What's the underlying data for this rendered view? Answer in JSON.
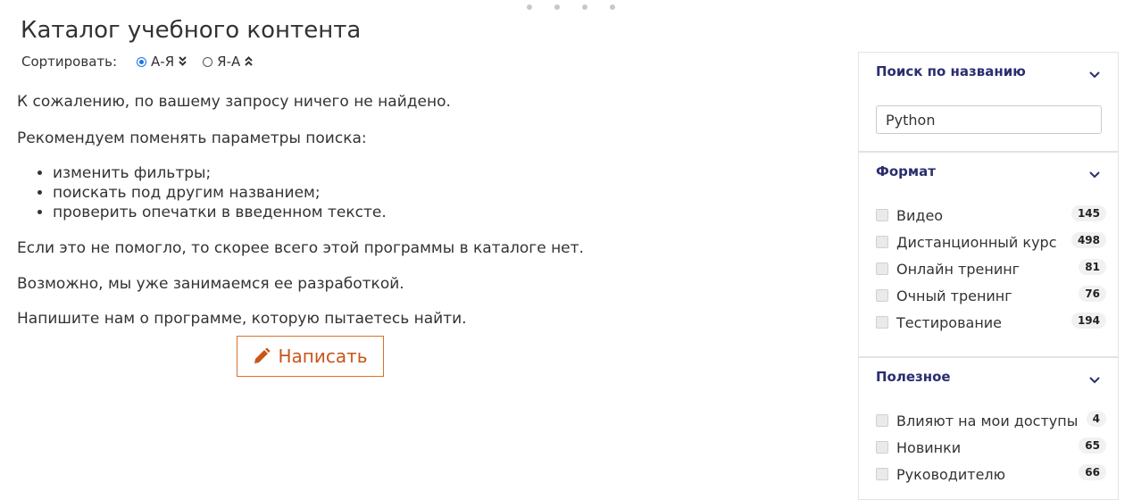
{
  "page": {
    "title": "Каталог учебного контента",
    "sort_label": "Сортировать:",
    "sort_options": [
      {
        "label": "А-Я",
        "checked": true,
        "direction": "descending-arrows"
      },
      {
        "label": "Я-А",
        "checked": false,
        "direction": "ascending-arrows"
      }
    ]
  },
  "message": {
    "not_found": "К сожалению, по вашему запросу ничего не найдено.",
    "recommend": "Рекомендуем поменять параметры поиска:",
    "tips": [
      "изменить фильтры;",
      "поискать под другим названием;",
      "проверить опечатки в введенном тексте."
    ],
    "not_helped": "Если это не помогло, то скорее всего этой программы в каталоге нет.",
    "developing": "Возможно, мы уже занимаемся ее разработкой.",
    "write_us": "Напишите нам о программе, которую пытаетесь найти.",
    "write_button": "Написать"
  },
  "sidebar": {
    "search": {
      "title": "Поиск по названию",
      "value": "Python"
    },
    "format": {
      "title": "Формат",
      "items": [
        {
          "label": "Видео",
          "count": "145"
        },
        {
          "label": "Дистанционный курс",
          "count": "498"
        },
        {
          "label": "Онлайн тренинг",
          "count": "81"
        },
        {
          "label": "Очный тренинг",
          "count": "76"
        },
        {
          "label": "Тестирование",
          "count": "194"
        }
      ]
    },
    "useful": {
      "title": "Полезное",
      "items": [
        {
          "label": "Влияют на мои доступы",
          "count": "4"
        },
        {
          "label": "Новинки",
          "count": "65"
        },
        {
          "label": "Руководителю",
          "count": "66"
        }
      ]
    }
  },
  "colors": {
    "accent": "#c8551a",
    "heading": "#2b2e6e",
    "radio": "#1a73e8"
  },
  "icons": [
    "pencil-icon",
    "chevron-down-icon",
    "double-chevron-down-icon",
    "double-chevron-up-icon"
  ]
}
